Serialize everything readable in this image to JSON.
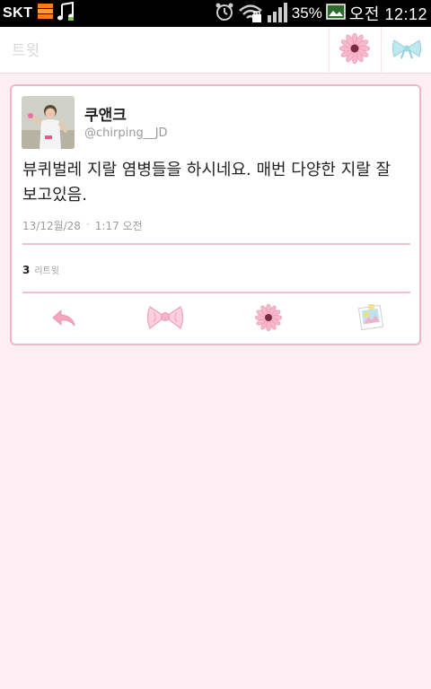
{
  "status_bar": {
    "carrier": "SKT",
    "battery_percent": "35%",
    "time": "오전 12:12"
  },
  "header": {
    "title": "트윗"
  },
  "tweet": {
    "display_name": "쿠앤크",
    "handle": "@chirping__JD",
    "text": "뷰퀴벌레 지랄 염병들을 하시네요. 매번 다양한 지랄 잘 보고있음.",
    "date": "13/12월/28",
    "separator": "·",
    "time": "1:17 오전",
    "retweet_count": "3",
    "retweet_label": "리트윗"
  },
  "icons": {
    "reply": "reply-arrow-icon",
    "retweet": "pink-bow-icon",
    "favorite": "pink-daisy-icon",
    "more": "photo-icon",
    "header_left": "pink-daisy-icon",
    "header_right": "blue-bow-icon"
  },
  "colors": {
    "background": "#fdeef3",
    "card_border": "#f2b6c9",
    "divider": "#efbfd0",
    "accent_pink": "#f4a6bd",
    "bow_blue": "#9fd9e6"
  }
}
